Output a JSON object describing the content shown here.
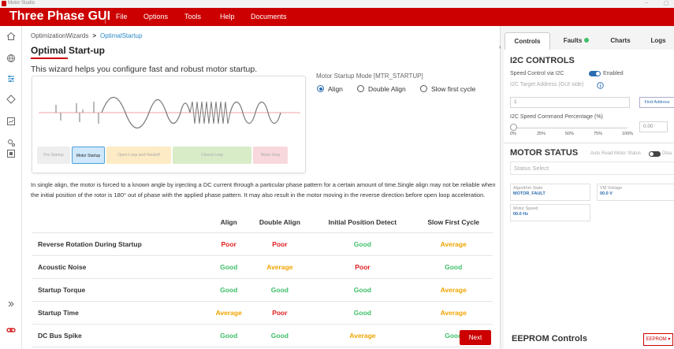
{
  "titlebar": {
    "app_name": "Motor Studio",
    "minimize": "–",
    "restore": "▢"
  },
  "menubar": {
    "title": "Three Phase GUI",
    "items": [
      "File",
      "Options",
      "Tools",
      "Help",
      "Documents"
    ]
  },
  "breadcrumb": {
    "parent": "OptimizationWizards",
    "separator": ">",
    "current": "OptimalStartup"
  },
  "page": {
    "title": "Optimal Start-up",
    "intro": "This wizard helps you configure fast and robust motor startup.",
    "stages": [
      "Pre-Startup",
      "Motor Startup",
      "Open-Loop and Handoff",
      "Closed Loop",
      "Motor Stop"
    ],
    "mode_label": "Motor Startup Mode [MTR_STARTUP]",
    "modes": [
      {
        "label": "Align",
        "selected": true
      },
      {
        "label": "Double Align",
        "selected": false
      },
      {
        "label": "Slow first cycle",
        "selected": false
      }
    ],
    "description": "In single align, the motor is forced to a known angle by injecting a DC current through a particular phase pattern for a certain amount of time.Single align may not be reliable when the initial position of the rotor is 180° out of phase with the applied phase pattern. It may also result in the motor moving in the reverse direction before open loop acceleration.",
    "next_label": "Next"
  },
  "comparison": {
    "headers": [
      "",
      "Align",
      "Double Align",
      "Initial Position Detect",
      "Slow First Cycle"
    ],
    "rows": [
      {
        "label": "Reverse Rotation During Startup",
        "values": [
          "Poor",
          "Poor",
          "Good",
          "Average"
        ]
      },
      {
        "label": "Acoustic Noise",
        "values": [
          "Good",
          "Average",
          "Poor",
          "Good"
        ]
      },
      {
        "label": "Startup Torque",
        "values": [
          "Good",
          "Good",
          "Good",
          "Average"
        ]
      },
      {
        "label": "Startup Time",
        "values": [
          "Average",
          "Poor",
          "Good",
          "Average"
        ]
      },
      {
        "label": "DC Bus Spike",
        "values": [
          "Good",
          "Good",
          "Average",
          "Good"
        ]
      }
    ]
  },
  "colors": {
    "brand": "#cc0000",
    "good": "#3fbf6a",
    "average": "#f0a500",
    "poor": "#e02020",
    "link": "#2b8ac6"
  },
  "right_panel": {
    "tabs": [
      "Controls",
      "Faults",
      "Charts",
      "Logs"
    ],
    "i2c": {
      "title": "I2C CONTROLS",
      "speed_control_label": "Speed Control via I2C",
      "speed_control_state": "Enabled",
      "target_address_label": "I2C Target Address (GUI side)",
      "target_address_value": "1",
      "find_address": "Find Address",
      "speed_cmd_label": "I2C Speed Command Percentage (%)",
      "speed_cmd_value": "0.00",
      "speed_cmd_level": 0,
      "ticks": [
        "0%",
        "25%",
        "50%",
        "75%",
        "100%"
      ]
    },
    "motor_status": {
      "title": "MOTOR STATUS",
      "auto_read_label": "Auto Read Motor Status",
      "auto_read_state": "Disa",
      "status_select": "Status Select",
      "cards": [
        {
          "key": "Algorithm State",
          "value": "MOTOR_FAULT"
        },
        {
          "key": "VM Voltage",
          "value": "00.0 V"
        },
        {
          "key": "Motor Speed",
          "value": "00.0 Hz"
        }
      ]
    },
    "eeprom": {
      "title": "EEPROM Controls",
      "button": "EEPROM ▾"
    }
  }
}
